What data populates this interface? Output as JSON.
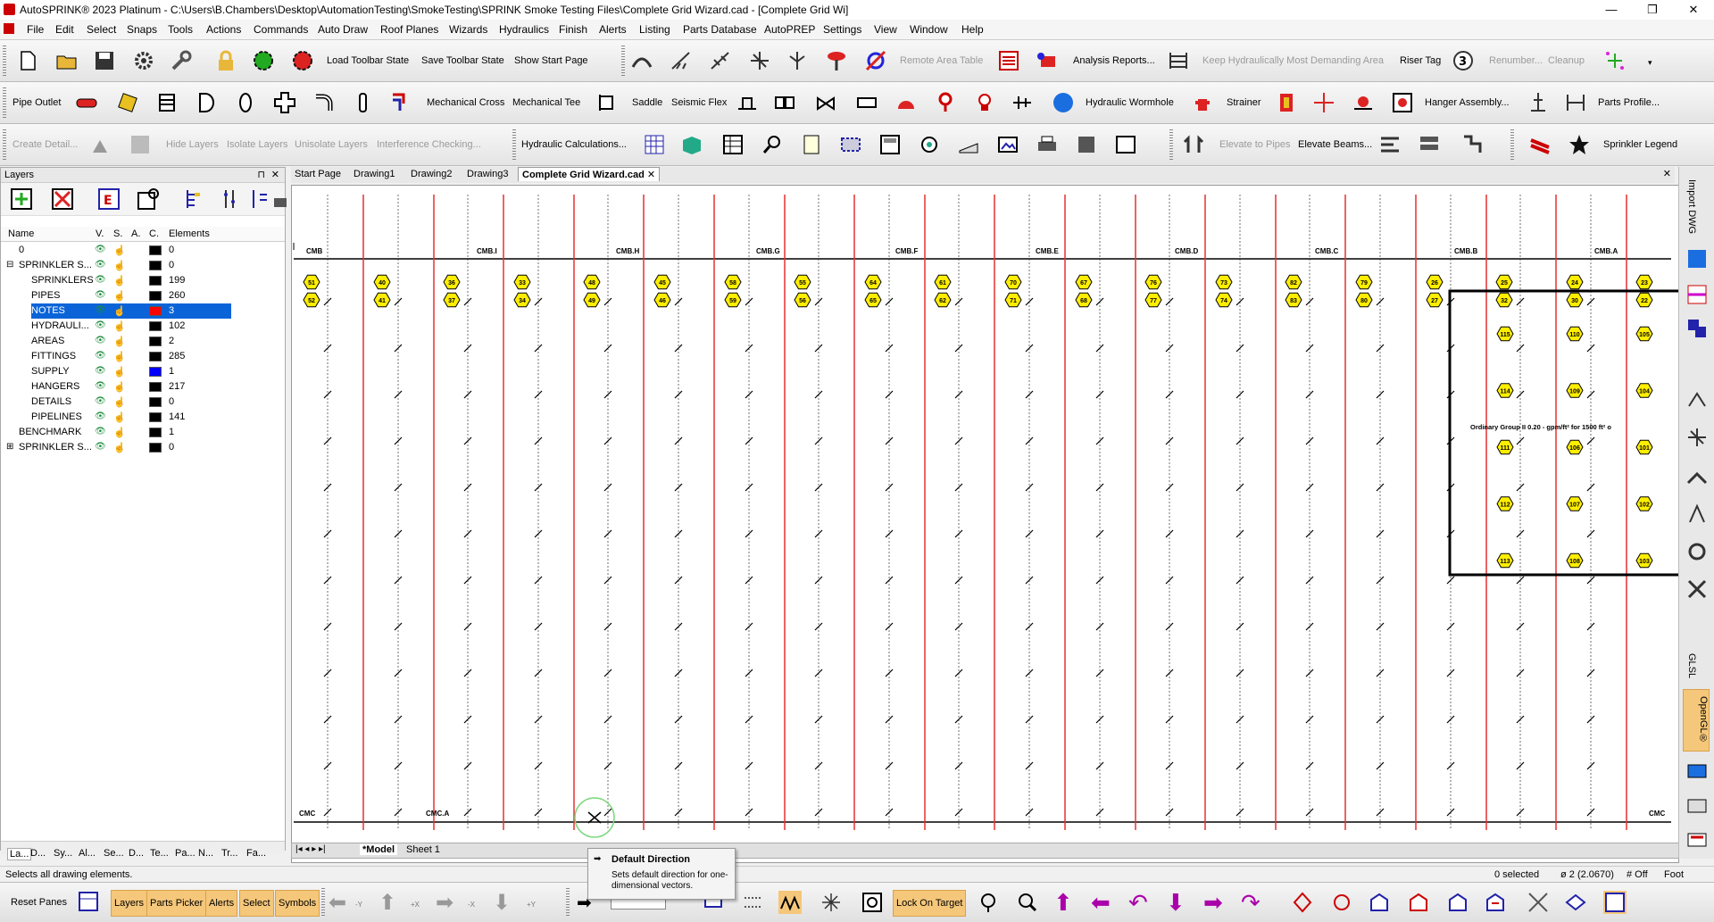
{
  "window": {
    "title": "AutoSPRINK® 2023 Platinum - C:\\Users\\B.Chambers\\Desktop\\AutomationTesting\\SmokeTesting\\SPRINK Smoke Testing Files\\Complete Grid Wizard.cad - [Complete Grid Wi]"
  },
  "menu": [
    "File",
    "Edit",
    "Select",
    "Snaps",
    "Tools",
    "Actions",
    "Commands",
    "Auto Draw",
    "Roof Planes",
    "Wizards",
    "Hydraulics",
    "Finish",
    "Alerts",
    "Listing",
    "Parts Database",
    "AutoPREP",
    "Settings",
    "View",
    "Window",
    "Help"
  ],
  "toolbar1": {
    "load_state": "Load Toolbar State",
    "save_state": "Save Toolbar State",
    "show_start": "Show Start Page",
    "remote_area": "Remote Area Table",
    "analysis": "Analysis Reports...",
    "keep_hydraulic": "Keep Hydraulically Most Demanding Area",
    "riser_tag": "Riser Tag",
    "renumber": "Renumber...",
    "cleanup": "Cleanup"
  },
  "toolbar2": {
    "pipe_outlet": "Pipe Outlet",
    "mech_cross": "Mechanical Cross",
    "mech_tee": "Mechanical Tee",
    "saddle": "Saddle",
    "seismic": "Seismic Flex",
    "wormhole": "Hydraulic Wormhole",
    "strainer": "Strainer",
    "hanger": "Hanger Assembly...",
    "profile": "Parts Profile..."
  },
  "toolbar3": {
    "create_detail": "Create Detail...",
    "hide_layers": "Hide Layers",
    "isolate_layers": "Isolate Layers",
    "unisolate": "Unisolate Layers",
    "interference": "Interference Checking...",
    "hyd_calc": "Hydraulic Calculations...",
    "elevate_pipes": "Elevate to Pipes",
    "elevate_beams": "Elevate Beams...",
    "sprinkler_legend": "Sprinkler Legend"
  },
  "layers_panel": {
    "title": "Layers",
    "columns": [
      "Name",
      "V.",
      "S.",
      "A.",
      "C.",
      "Elements"
    ],
    "rows": [
      {
        "name": "0",
        "color": "#000000",
        "elements": "0",
        "indent": 0,
        "exp": ""
      },
      {
        "name": "SPRINKLER S...",
        "color": "#000000",
        "elements": "0",
        "indent": 0,
        "exp": "⊟"
      },
      {
        "name": "SPRINKLERS",
        "color": "#000000",
        "elements": "199",
        "indent": 1,
        "exp": ""
      },
      {
        "name": "PIPES",
        "color": "#000000",
        "elements": "260",
        "indent": 1,
        "exp": ""
      },
      {
        "name": "NOTES",
        "color": "#ff0000",
        "elements": "3",
        "indent": 1,
        "exp": "",
        "selected": true
      },
      {
        "name": "HYDRAULI...",
        "color": "#000000",
        "elements": "102",
        "indent": 1,
        "exp": ""
      },
      {
        "name": "AREAS",
        "color": "#000000",
        "elements": "2",
        "indent": 1,
        "exp": ""
      },
      {
        "name": "FITTINGS",
        "color": "#000000",
        "elements": "285",
        "indent": 1,
        "exp": ""
      },
      {
        "name": "SUPPLY",
        "color": "#0000ff",
        "elements": "1",
        "indent": 1,
        "exp": ""
      },
      {
        "name": "HANGERS",
        "color": "#000000",
        "elements": "217",
        "indent": 1,
        "exp": ""
      },
      {
        "name": "DETAILS",
        "color": "#000000",
        "elements": "0",
        "indent": 1,
        "exp": ""
      },
      {
        "name": "PIPELINES",
        "color": "#000000",
        "elements": "141",
        "indent": 1,
        "exp": ""
      },
      {
        "name": "BENCHMARK",
        "color": "#000000",
        "elements": "1",
        "indent": 0,
        "exp": ""
      },
      {
        "name": "SPRINKLER S...",
        "color": "#000000",
        "elements": "0",
        "indent": 0,
        "exp": "⊞"
      }
    ],
    "bottom_tabs": [
      "La...",
      "D...",
      "Sy...",
      "Al...",
      "Se...",
      "D...",
      "Te...",
      "Pa...",
      "N...",
      "Tr...",
      "Fa..."
    ]
  },
  "doc_tabs": [
    "Start Page",
    "Drawing1",
    "Drawing2",
    "Drawing3",
    "Complete Grid Wizard.cad"
  ],
  "sheet_tabs": [
    "*Model",
    "Sheet 1"
  ],
  "drawing": {
    "top_mains": [
      "CMB",
      "CMB.I",
      "CMB.H",
      "CMB.G",
      "CMB.F",
      "CMB.E",
      "CMB.D",
      "CMB.C",
      "CMB.B",
      "CMB.A"
    ],
    "bottom_mains": [
      "CMC",
      "CMC.A",
      "CMC"
    ],
    "head_pairs": [
      [
        "51",
        "52"
      ],
      [
        "40",
        "41"
      ],
      [
        "36",
        "37"
      ],
      [
        "33",
        "34"
      ],
      [
        "48",
        "49"
      ],
      [
        "45",
        "46"
      ],
      [
        "58",
        "59"
      ],
      [
        "55",
        "56"
      ],
      [
        "64",
        "65"
      ],
      [
        "61",
        "62"
      ],
      [
        "70",
        "71"
      ],
      [
        "67",
        "68"
      ],
      [
        "76",
        "77"
      ],
      [
        "73",
        "74"
      ],
      [
        "82",
        "83"
      ],
      [
        "79",
        "80"
      ],
      [
        "26",
        "27"
      ],
      [
        "25",
        "32"
      ],
      [
        "24",
        "30"
      ],
      [
        "23",
        "22"
      ]
    ],
    "remote_rows": [
      [
        "115",
        "110",
        "105"
      ],
      [
        "114",
        "109",
        "104"
      ],
      [
        "111",
        "106",
        "101"
      ],
      [
        "112",
        "107",
        "102"
      ],
      [
        "113",
        "108",
        "103"
      ]
    ],
    "area_note": "Ordinary Group II 0.20 - gpm/ft² for 1500 ft² o"
  },
  "right_strip": {
    "import_dwg": "Import DWG",
    "glsl": "GLSL",
    "opengl": "OpenGL®"
  },
  "status": {
    "hint": "Selects all drawing elements.",
    "selected": "0 selected",
    "dia": "ø 2 (2.0670)",
    "mode": "# Off",
    "unit": "Foot"
  },
  "tooltip": {
    "title": "Default Direction",
    "body": "Sets default direction for one-dimensional vectors."
  },
  "bottom_buttons": {
    "reset": "Reset Panes",
    "layers": "Layers",
    "parts_picker": "Parts Picker",
    "alerts": "Alerts",
    "select": "Select",
    "symbols": "Symbols",
    "lock_target": "Lock On Target"
  },
  "axis_labels": [
    "-Y",
    "+X",
    "-X",
    "+Y",
    "-X"
  ]
}
